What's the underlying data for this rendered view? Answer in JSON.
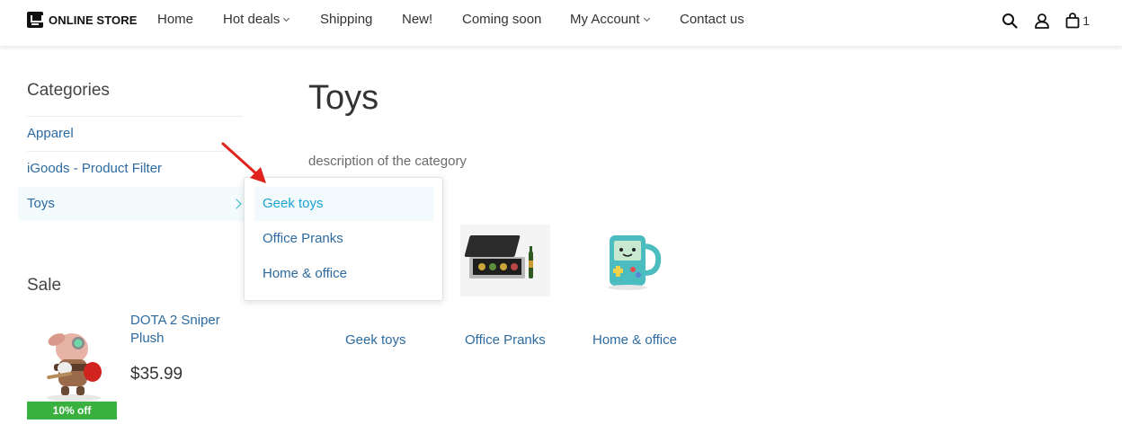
{
  "header": {
    "logo_text": "ONLINE STORE",
    "nav": [
      {
        "label": "Home",
        "has_caret": false
      },
      {
        "label": "Hot deals",
        "has_caret": true
      },
      {
        "label": "Shipping",
        "has_caret": false
      },
      {
        "label": "New!",
        "has_caret": false
      },
      {
        "label": "Coming soon",
        "has_caret": false
      },
      {
        "label": "My Account",
        "has_caret": true
      },
      {
        "label": "Contact us",
        "has_caret": false
      }
    ],
    "cart_count": "1"
  },
  "sidebar": {
    "title": "Categories",
    "items": [
      {
        "label": "Apparel"
      },
      {
        "label": "iGoods - Product Filter"
      },
      {
        "label": "Toys",
        "active": true
      }
    ],
    "sale": {
      "title": "Sale",
      "product_name": "DOTA 2 Sniper Plush",
      "price": "$35.99",
      "badge": "10% off"
    }
  },
  "main": {
    "title": "Toys",
    "description": "description of the category",
    "subcategories": [
      {
        "label": "Geek toys"
      },
      {
        "label": "Office Pranks"
      },
      {
        "label": "Home & office"
      }
    ]
  },
  "dropdown": {
    "items": [
      {
        "label": "Geek toys",
        "hovered": true
      },
      {
        "label": "Office Pranks"
      },
      {
        "label": "Home & office"
      }
    ]
  },
  "colors": {
    "link": "#2c6aa0",
    "hover_link": "#1aa4d0",
    "badge": "#3ab03e",
    "arrow": "#e0231c"
  }
}
